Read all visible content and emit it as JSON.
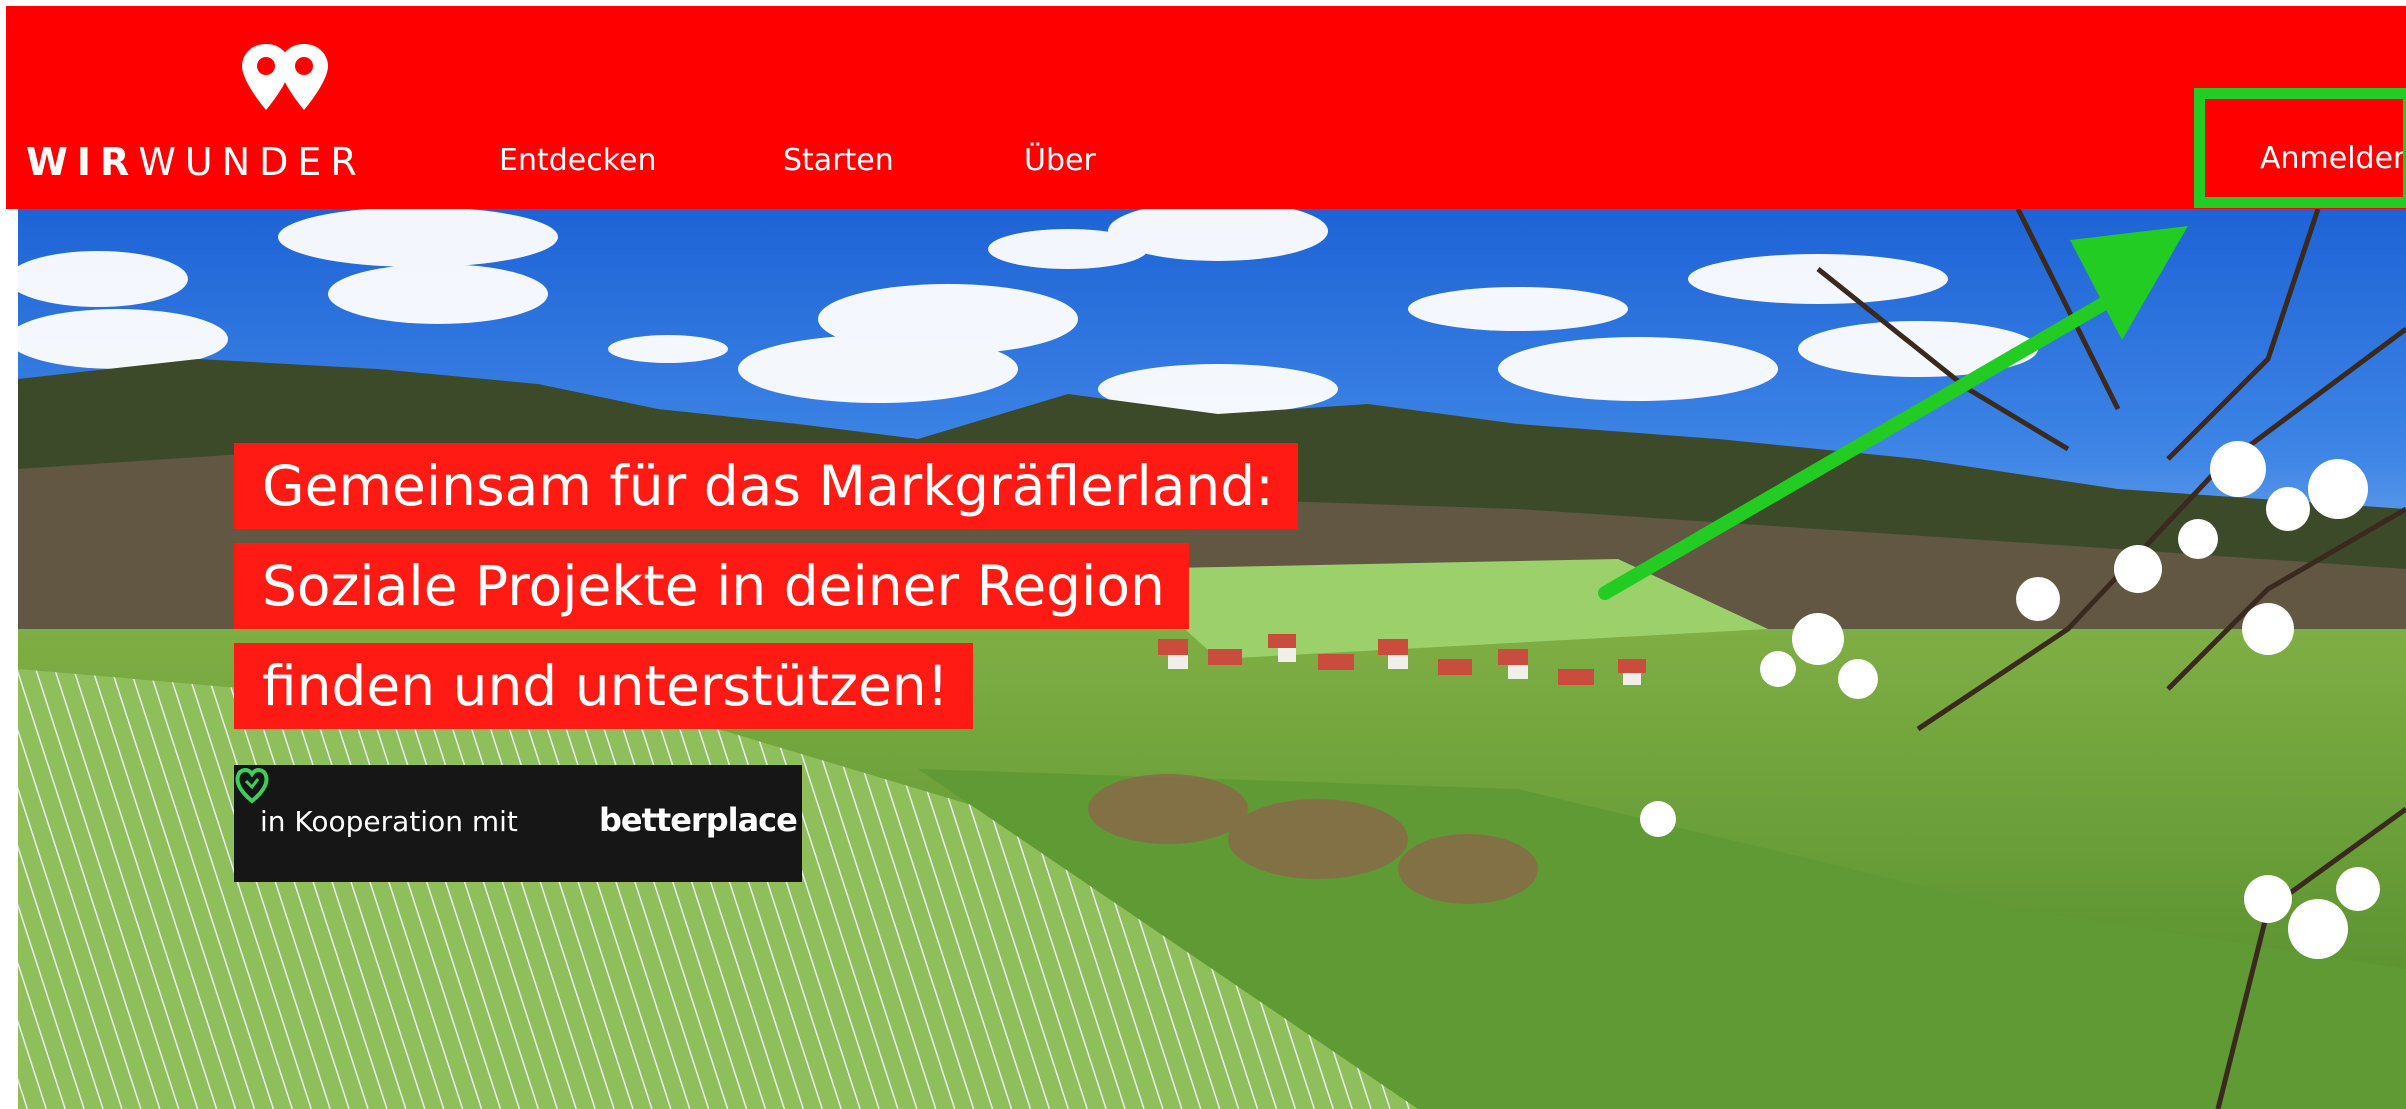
{
  "header": {
    "brand_bold": "WIR",
    "brand_light": "WUNDER",
    "nav": [
      "Entdecken",
      "Starten",
      "Über"
    ],
    "login_label": "Anmelden"
  },
  "hero": {
    "headline": [
      "Gemeinsam für das Markgräflerland:",
      "Soziale Projekte in deiner Region",
      "finden und unterstützen!"
    ],
    "coop_label": "in Kooperation mit",
    "partner_name": "betterplace"
  },
  "colors": {
    "header_bg": "#ff0000",
    "headline_bg": "#ff1a14",
    "highlight": "#22cc22",
    "coop_bg": "#161616"
  },
  "icons": {
    "logo": "double-location-pin-icon",
    "partner": "heart-leaf-icon"
  }
}
